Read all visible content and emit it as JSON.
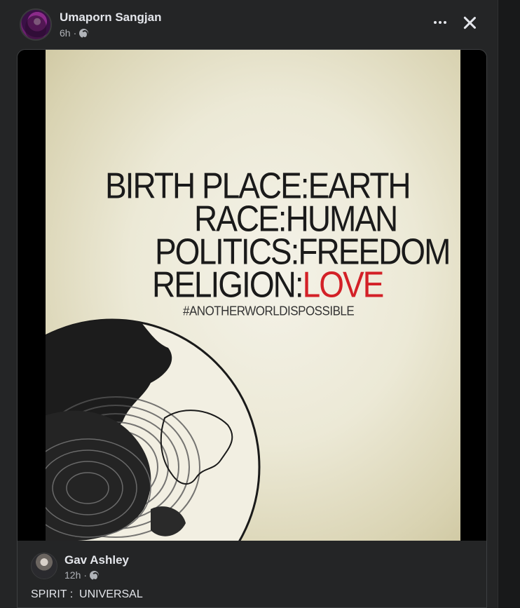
{
  "post": {
    "author": "Umaporn Sangjan",
    "time": "6h",
    "separator": "·",
    "privacy_icon": "globe-icon",
    "more_icon": "more-options-icon",
    "close_icon": "close-icon"
  },
  "poster": {
    "line1_label": "BIRTH PLACE:",
    "line1_value": "EARTH",
    "line2_label": "RACE:",
    "line2_value": "HUMAN",
    "line3_label": "POLITICS:",
    "line3_value": "FREEDOM",
    "line4_label": "RELIGION:",
    "line4_value": "LOVE",
    "hashtag": "#ANOTHERWORLDISPOSSIBLE",
    "accent_color": "#d32027"
  },
  "comment": {
    "author": "Gav Ashley",
    "time": "12h",
    "separator": "·",
    "privacy_icon": "globe-icon",
    "text": "SPIRIT :  UNIVERSAL"
  }
}
